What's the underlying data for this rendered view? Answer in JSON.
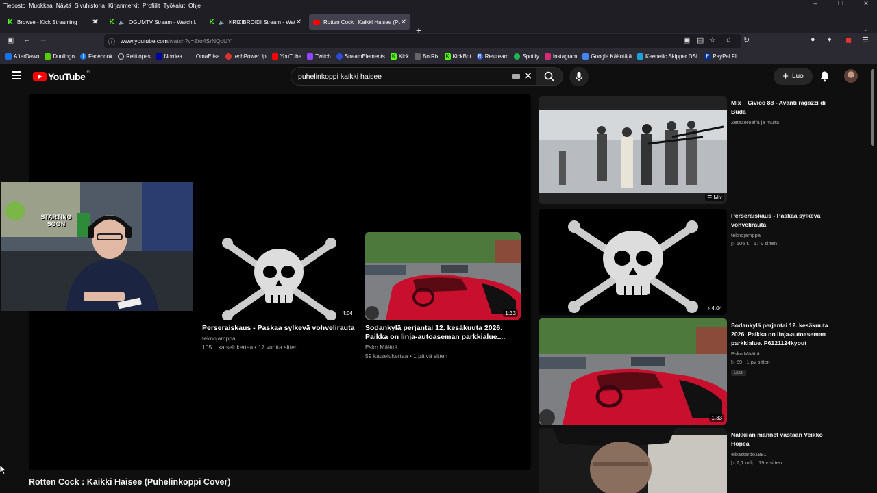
{
  "menubar": {
    "items": [
      "Tiedosto",
      "Muokkaa",
      "Näytä",
      "Sivuhistoria",
      "Kirjanmerkit",
      "Profiilit",
      "Työkalut",
      "Ohje"
    ]
  },
  "tabs": [
    {
      "title": "Browse - Kick Streaming",
      "icon": "kick-icon",
      "audio": false,
      "active": false
    },
    {
      "title": "OGUMTV Stream - Watch Live",
      "icon": "kick-icon",
      "audio": true,
      "active": false
    },
    {
      "title": "KRIZIBROIDI Stream - Watch Live",
      "icon": "kick-icon",
      "audio": true,
      "active": false
    },
    {
      "title": "Rotten Cock : Kaikki Haisee (Puhelinkoppi Cover)",
      "icon": "youtube-icon",
      "audio": false,
      "active": true
    }
  ],
  "url": {
    "host": "www.youtube.com",
    "path": "/watch?v=Zto4SrNQcUY"
  },
  "bookmarks": [
    {
      "label": "AfterDawn",
      "color": "#1a73e8"
    },
    {
      "label": "Duolingo",
      "color": "#58cc02"
    },
    {
      "label": "Facebook",
      "color": "#1877f2"
    },
    {
      "label": "Reittiopas",
      "color": "#555"
    },
    {
      "label": "Nordea",
      "color": "#0000a0"
    },
    {
      "label": "OmaElisa",
      "color": "#2b2a33"
    },
    {
      "label": "techPowerUp",
      "color": "#d33"
    },
    {
      "label": "YouTube",
      "color": "#f00"
    },
    {
      "label": "Twitch",
      "color": "#9146ff"
    },
    {
      "label": "StreamElements",
      "color": "#2b4bd8"
    },
    {
      "label": "Kick",
      "color": "#53fc18"
    },
    {
      "label": "BotRix",
      "color": "#666"
    },
    {
      "label": "KickBot",
      "color": "#53fc18"
    },
    {
      "label": "Restream",
      "color": "#3a5bd9"
    },
    {
      "label": "Spotify",
      "color": "#1db954"
    },
    {
      "label": "Instagram",
      "color": "#d62976"
    },
    {
      "label": "Google Kääntäjä",
      "color": "#4285f4"
    },
    {
      "label": "Keenetic Skipper DSL",
      "color": "#1ea0dc"
    },
    {
      "label": "PayPal FI",
      "color": "#003087"
    }
  ],
  "youtube": {
    "logo": "YouTube",
    "region": "FI",
    "search_value": "puhelinkoppi kaikki haisee",
    "create_label": "Luo"
  },
  "endcards": [
    {
      "title": "Perseraiskaus - Paskaa sylkevä vohvelirauta",
      "channel": "teknojamppa",
      "meta": "105 t. katselukertaa • 17 vuotta sitten",
      "duration": "4:04"
    },
    {
      "title": "Sodankylä perjantai 12. kesäkuuta 2026. Paikka on linja-autoaseman parkkialue....",
      "channel": "Esko Määttä",
      "meta": "59 katselukertaa • 1 päivä sitten",
      "duration": "1:33"
    }
  ],
  "video_title": "Rotten Cock : Kaikki Haisee (Puhelinkoppi Cover)",
  "webcam_sign": "STARTING SOON",
  "recommendations": [
    {
      "title": "Mix – Civico 88 - Avanti ragazzi di Buda",
      "channel": "Zetazeroalfa ja muita",
      "views": "",
      "age": "",
      "duration": "Mix",
      "badge": ""
    },
    {
      "title": "Perseraiskaus - Paskaa sylkevä vohvelirauta",
      "channel": "teknojamppa",
      "views": "105 t.",
      "age": "17 v sitten",
      "duration": "4.04",
      "badge": ""
    },
    {
      "title": "Sodankylä  perjantai 12. kesäkuuta 2026. Paikka on linja-autoaseman parkkialue. P6121124kyout",
      "channel": "Esko Määttä",
      "views": "59",
      "age": "1 pv sitten",
      "duration": "1.33",
      "badge": "Uusi"
    },
    {
      "title": "Nakkilan mannet vastaan Veikko Hopea",
      "channel": "elbastardo1891",
      "views": "2,1 milj.",
      "age": "19 v sitten",
      "duration": "",
      "badge": ""
    }
  ],
  "colors": {
    "yt_bg": "#0f0f0f",
    "yt_red": "#ff0000",
    "firefox_toolbar": "#2b2a33"
  }
}
